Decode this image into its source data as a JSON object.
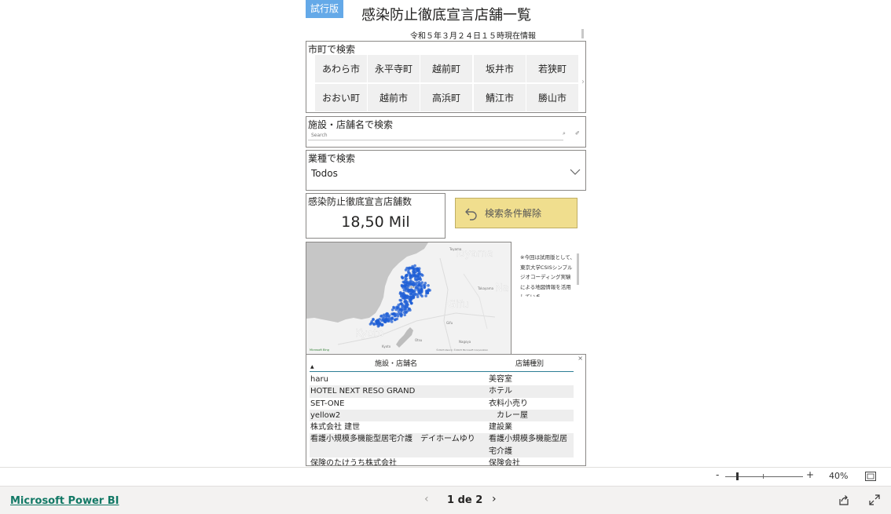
{
  "report": {
    "trial_badge": "試行版",
    "title": "感染防止徹底宣言店舗一覧",
    "update_info": "令和５年３月２４日１５時現在情報"
  },
  "city_slicer": {
    "title": "市町で検索",
    "row1": [
      "あわら市",
      "永平寺町",
      "越前町",
      "坂井市",
      "若狭町"
    ],
    "row2": [
      "おおい町",
      "越前市",
      "高浜町",
      "鯖江市",
      "勝山市"
    ],
    "scroll_icon": "chevron-right-icon"
  },
  "name_search": {
    "title": "施設・店舗名で検索",
    "placeholder": "Search"
  },
  "industry_filter": {
    "title": "業種で検索",
    "value": "Todos"
  },
  "store_count": {
    "title": "感染防止徹底宣言店舗数",
    "value": "18,50 Mil"
  },
  "clear_button": {
    "label": "検索条件解除",
    "icon": "undo-icon",
    "color": "#f0de8e"
  },
  "map": {
    "labels": [
      "Toyama",
      "Gifu",
      "Kyoto",
      "Na"
    ],
    "small_labels": [
      "Toyama",
      "Fukui",
      "Takayama",
      "Gifu",
      "Nagoya",
      "Kyoto",
      "Otsu"
    ],
    "attribution": "©2023 Zenrin ©2023 Microsoft Corporation",
    "provider": "Microsoft Bing",
    "marker_color": "#1f5fd6"
  },
  "note": {
    "text": "※今回は試用版として、東京大学CSISシンプルジオコーディング実験による地図情報を活用していま"
  },
  "table": {
    "columns": [
      "施設・店舗名",
      "店舗種別"
    ],
    "rows": [
      [
        "haru",
        "美容室"
      ],
      [
        "HOTEL NEXT RESO GRAND",
        "ホテル"
      ],
      [
        "SET-ONE",
        "衣料小売り"
      ],
      [
        "yellow2",
        "　カレー屋"
      ],
      [
        "株式会社 建世",
        "建設業"
      ],
      [
        "看護小規模多機能型居宅介護　デイホームゆり",
        "看護小規模多機能型居宅介護"
      ],
      [
        "保険のたけうち株式会社",
        "保険会社"
      ]
    ]
  },
  "zoom": {
    "minus": "-",
    "plus": "+",
    "level": "40%",
    "fraction": 0.14
  },
  "footer": {
    "brand_link": "Microsoft Power BI",
    "page_indicator": "1 de 2"
  }
}
